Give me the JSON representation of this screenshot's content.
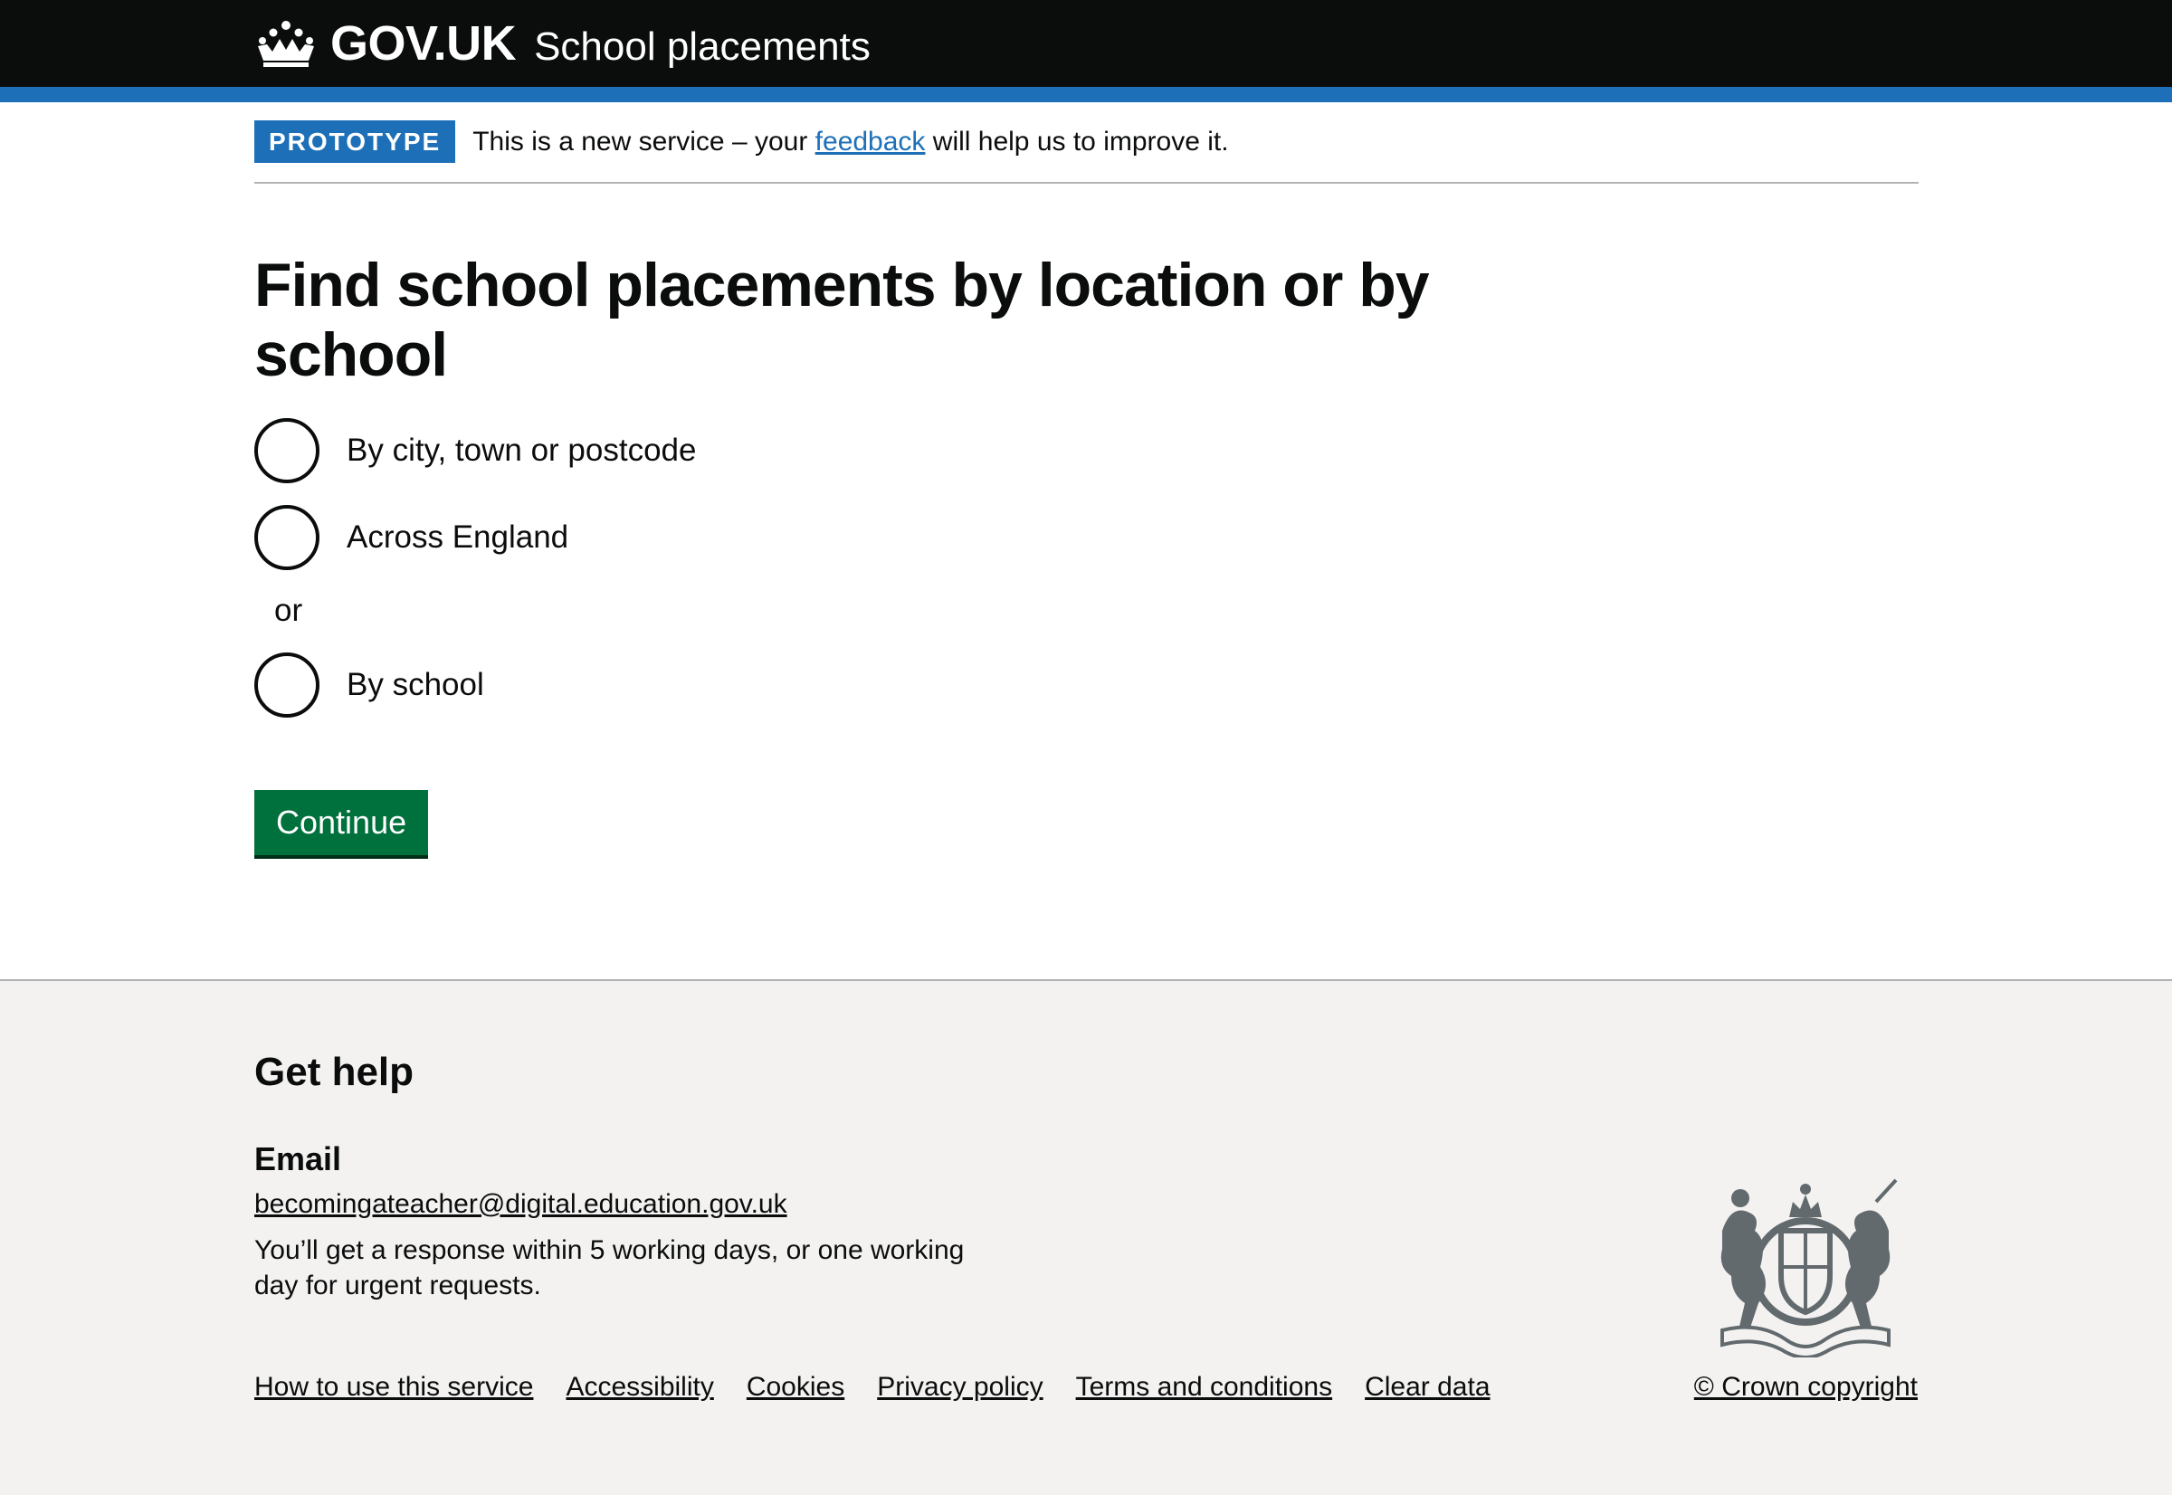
{
  "header": {
    "logo_text": "GOV.UK",
    "service_name": "School placements",
    "logo_icon": "crown-icon"
  },
  "phase_banner": {
    "tag": "PROTOTYPE",
    "text_before": "This is a new service – your ",
    "link": "feedback",
    "text_after": " will help us to improve it."
  },
  "main": {
    "heading": "Find school placements by location or by school",
    "options": [
      {
        "label": "By city, town or postcode",
        "selected": false
      },
      {
        "label": "Across England",
        "selected": false
      },
      {
        "label": "By school",
        "selected": false
      }
    ],
    "divider": "or",
    "button": "Continue"
  },
  "footer": {
    "heading": "Get help",
    "email_heading": "Email",
    "email": "becomingateacher@digital.education.gov.uk",
    "response": "You’ll get a response within 5 working days, or one working day for urgent requests.",
    "links": [
      "How to use this service",
      "Accessibility",
      "Cookies",
      "Privacy policy",
      "Terms and conditions",
      "Clear data"
    ],
    "copyright": "© Crown copyright",
    "crest_icon": "royal-coat-of-arms-icon"
  },
  "colors": {
    "header_bg": "#0b0c0c",
    "brand_blue": "#1d70b8",
    "button_green": "#00703c",
    "footer_bg": "#f3f2f1"
  }
}
